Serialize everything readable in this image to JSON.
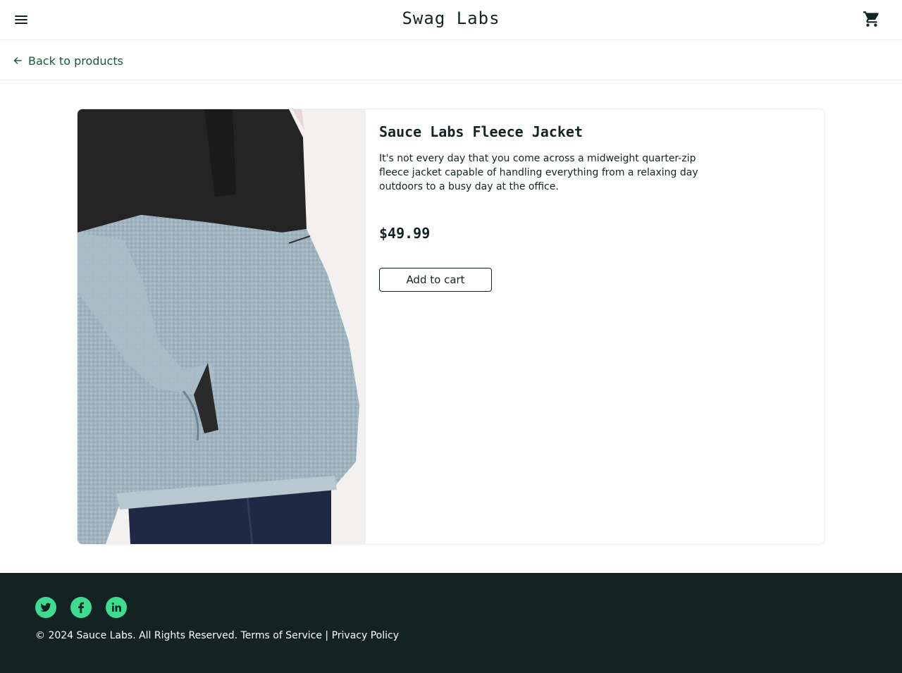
{
  "header": {
    "title": "Swag Labs",
    "menu_icon": "hamburger-menu-icon",
    "cart_icon": "shopping-cart-icon"
  },
  "subheader": {
    "back_label": "Back to products",
    "back_icon": "arrow-left-icon"
  },
  "product": {
    "name": "Sauce Labs Fleece Jacket",
    "description": "It's not every day that you come across a midweight quarter-zip fleece jacket capable of handling everything from a relaxing day outdoors to a busy day at the office.",
    "price": "$49.99",
    "add_to_cart_label": "Add to cart",
    "image_alt": "Sauce Labs Fleece Jacket"
  },
  "footer": {
    "social": [
      "twitter-icon",
      "facebook-icon",
      "linkedin-icon"
    ],
    "copyright": "© 2024 Sauce Labs. All Rights Reserved.",
    "terms": "Terms of Service",
    "separator": "|",
    "privacy": "Privacy Policy"
  },
  "colors": {
    "brand_dark": "#132322",
    "accent_green": "#3ddc91",
    "link_green": "#18583a",
    "border": "#ededef"
  }
}
